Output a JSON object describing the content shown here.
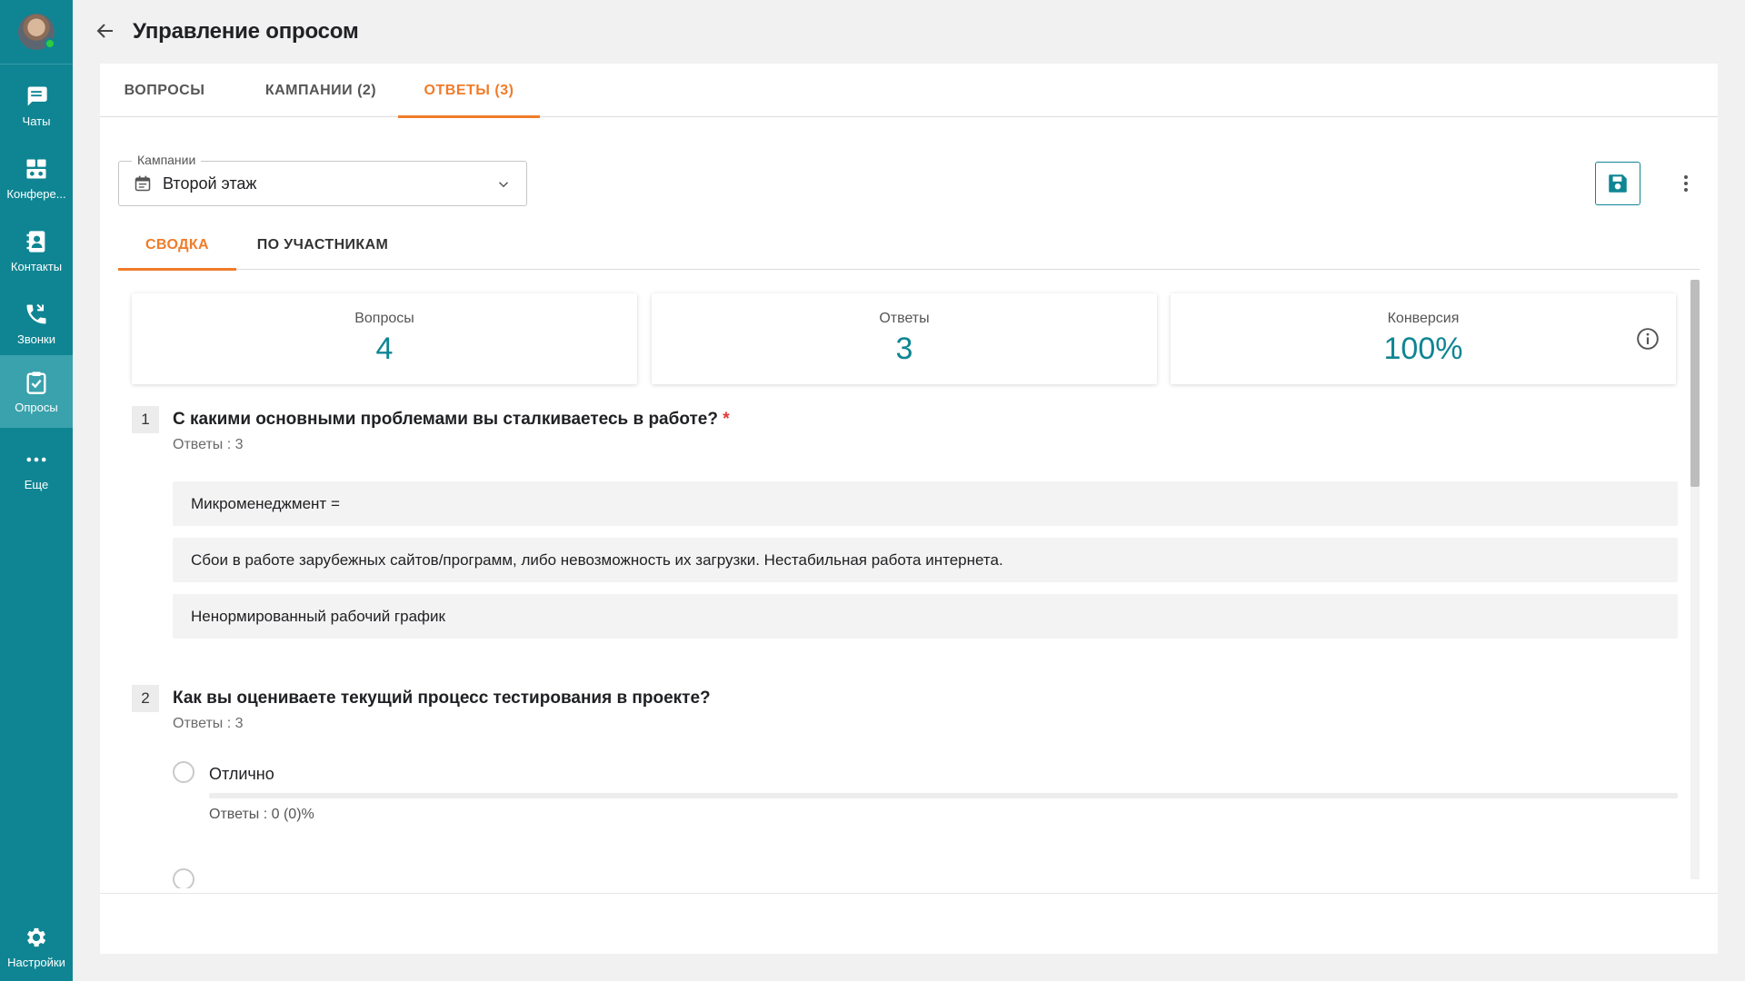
{
  "app": {
    "title": "Управление опросом"
  },
  "sidebar": {
    "items": [
      {
        "label": "Чаты",
        "icon": "chat-icon"
      },
      {
        "label": "Конфере...",
        "icon": "conference-icon"
      },
      {
        "label": "Контакты",
        "icon": "contacts-icon"
      },
      {
        "label": "Звонки",
        "icon": "calls-icon"
      },
      {
        "label": "Опросы",
        "icon": "surveys-icon",
        "active": true
      },
      {
        "label": "Еще",
        "icon": "more-dots-icon"
      }
    ],
    "settings_label": "Настройки"
  },
  "tabs": [
    {
      "label": "ВОПРОСЫ"
    },
    {
      "label": "КАМПАНИИ (2)"
    },
    {
      "label": "ОТВЕТЫ (3)",
      "active": true
    }
  ],
  "campaign_select": {
    "label": "Кампании",
    "value": "Второй этаж"
  },
  "subtabs": [
    {
      "label": "СВОДКА",
      "active": true
    },
    {
      "label": "ПО УЧАСТНИКАМ"
    }
  ],
  "stats": [
    {
      "label": "Вопросы",
      "value": "4"
    },
    {
      "label": "Ответы",
      "value": "3"
    },
    {
      "label": "Конверсия",
      "value": "100%"
    }
  ],
  "questions": [
    {
      "number": "1",
      "title": "С какими основными проблемами вы сталкиваетесь в работе?",
      "required_mark": "*",
      "count": "Ответы : 3",
      "answers": [
        "Микроменеджмент =",
        "Сбои в работе зарубежных сайтов/программ, либо невозможность их загрузки. Нестабильная работа интернета.",
        "Ненормированный рабочий график"
      ]
    },
    {
      "number": "2",
      "title": "Как вы оцениваете текущий процесс тестирования в проекте?",
      "count": "Ответы : 3",
      "options": [
        {
          "label": "Отлично",
          "count": "Ответы : 0 (0)%",
          "fraction": 0
        }
      ]
    }
  ],
  "colors": {
    "sidebar": "#0f8593",
    "accent": "#f07c2a",
    "stat_value": "#0f8593",
    "required": "#e53935"
  }
}
